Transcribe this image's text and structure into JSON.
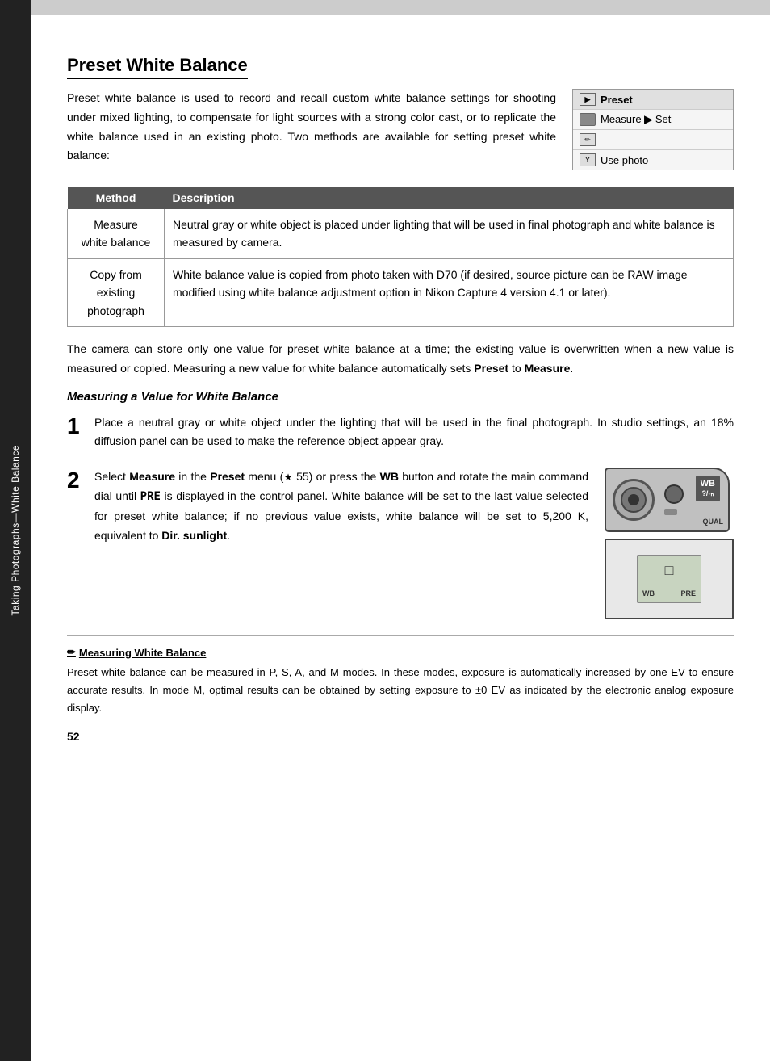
{
  "page": {
    "number": "52"
  },
  "topbar": {
    "color": "#cccccc"
  },
  "sidebar": {
    "label": "Taking Photographs—White Balance"
  },
  "title": "Preset White Balance",
  "intro_text": "Preset white balance is used to record and recall custom white balance settings for shooting under mixed lighting, to compensate for light sources with a strong color cast, or to replicate the white balance used in an existing photo.  Two methods are available for setting preset white balance:",
  "menu_diagram": {
    "items": [
      {
        "icon": "▶",
        "label": "Preset",
        "is_header": true
      },
      {
        "icon": "●",
        "label": "Measure ▶ Set"
      },
      {
        "icon": "✎",
        "label": ""
      },
      {
        "icon": "Y",
        "label": "Use photo"
      }
    ]
  },
  "table": {
    "headers": [
      "Method",
      "Description"
    ],
    "rows": [
      {
        "method": "Measure white balance",
        "description": "Neutral gray or white object is placed under lighting that will be used in final photograph and white balance is measured by camera."
      },
      {
        "method": "Copy from existing photograph",
        "description": "White balance value is copied from photo taken with D70 (if desired, source picture can be RAW image modified using white balance adjustment option in Nikon Capture 4 version 4.1 or later)."
      }
    ]
  },
  "body_text": "The camera can store only one value for preset white balance at a time; the existing  value is overwritten when a new value is measured or copied.  Measuring a new value for white balance automatically sets Preset to Measure.",
  "section_subtitle": "Measuring a Value for White Balance",
  "step1": {
    "number": "1",
    "text": "Place a neutral gray or white object under the lighting that will be used in the final photograph.  In studio settings, an 18% diffusion panel can be used to make the reference object appear gray."
  },
  "step2": {
    "number": "2",
    "text_part1": "Select ",
    "text_bold1": "Measure",
    "text_part2": " in the ",
    "text_bold2": "Preset",
    "text_part3": " menu (",
    "text_ref": "☆ 55",
    "text_part4": ") or press the ",
    "text_bold3": "WB",
    "text_part5": " button and rotate the main command dial until ",
    "text_pre": "PRE",
    "text_part6": " is displayed in the control panel.  White balance will be set to the last value selected for preset white balance; if no previous value exists, white balance will be set to 5,200 K, equivalent to ",
    "text_bold4": "Dir. sunlight",
    "text_part7": ".",
    "wb_label": "WB",
    "wb_sub": "?/◦ₙ",
    "qual_label": "QUAL",
    "lcd_wb": "WB",
    "lcd_pre": "PRE"
  },
  "note": {
    "title": "Measuring White Balance",
    "icon": "pencil",
    "text": "Preset white balance can be measured in P, S, A, and M modes.  In these modes, exposure is automatically increased by one EV to ensure accurate results.  In mode M, optimal results can be obtained by setting exposure to ±0 EV as indicated by the electronic analog exposure display."
  }
}
